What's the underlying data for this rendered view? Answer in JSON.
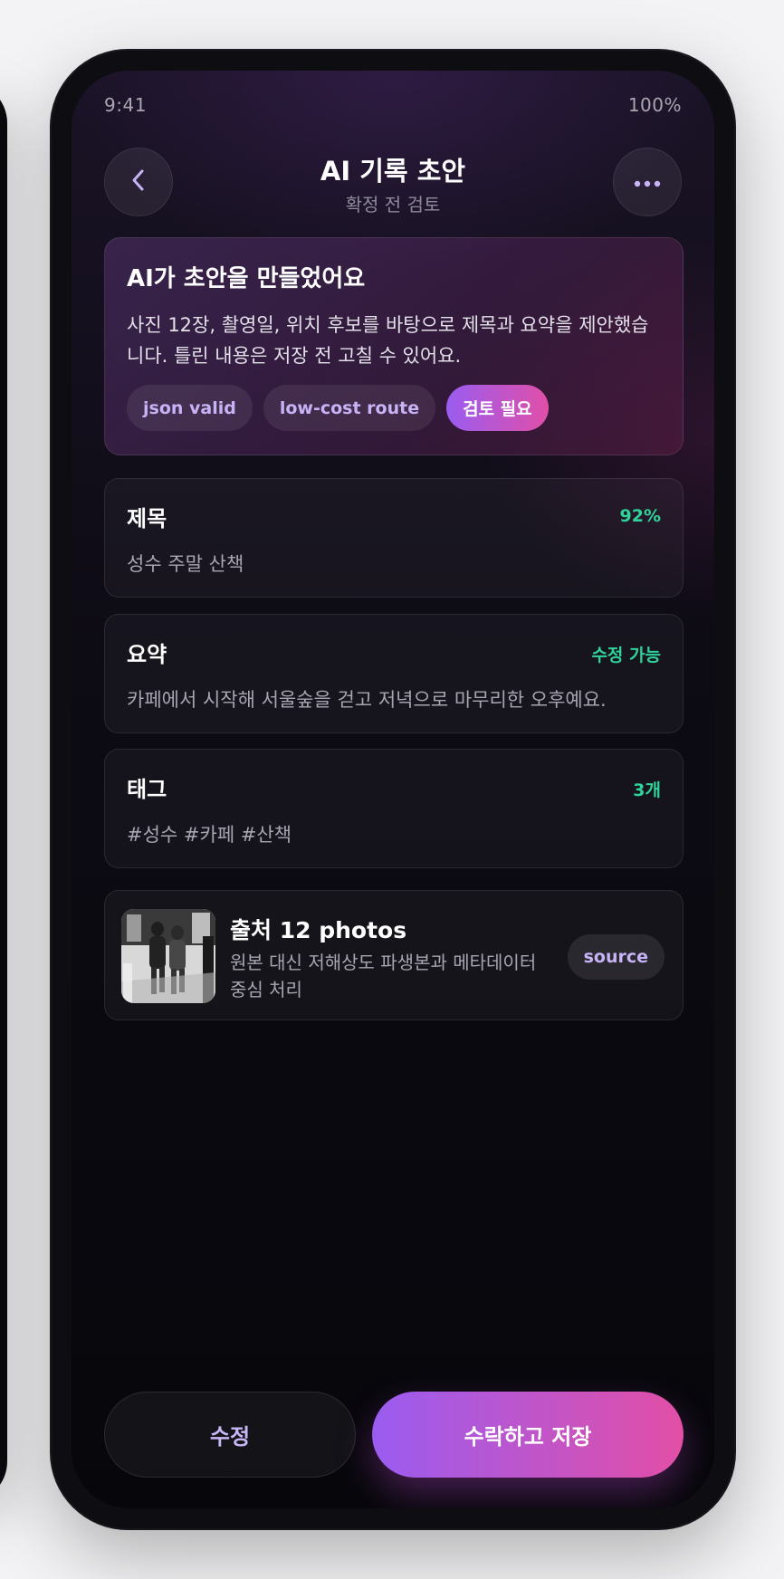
{
  "status_bar": {
    "time": "9:41",
    "battery": "100%"
  },
  "header": {
    "title": "AI 기록 초안",
    "subtitle": "확정 전 검토"
  },
  "hero": {
    "title": "AI가 초안을 만들었어요",
    "body": "사진 12장, 촬영일, 위치 후보를 바탕으로 제목과 요약을 제안했습니다. 틀린 내용은 저장 전 고칠 수 있어요.",
    "chips": [
      "json valid",
      "low-cost route",
      "검토 필요"
    ]
  },
  "fields": [
    {
      "label": "제목",
      "meta": "92%",
      "value": "성수 주말 산책"
    },
    {
      "label": "요약",
      "meta": "수정 가능",
      "value": "카페에서 시작해 서울숲을 걷고 저녁으로 마무리한 오후예요."
    },
    {
      "label": "태그",
      "meta": "3개",
      "value": "#성수 #카페 #산책"
    }
  ],
  "source": {
    "title": "출처 12 photos",
    "description": "원본 대신 저해상도 파생본과 메타데이터 중심 처리",
    "button": "source"
  },
  "actions": {
    "edit": "수정",
    "save": "수락하고 저장"
  },
  "colors": {
    "accent_start": "#9a5cf0",
    "accent_end": "#e24fa6",
    "success": "#2fd39a"
  }
}
